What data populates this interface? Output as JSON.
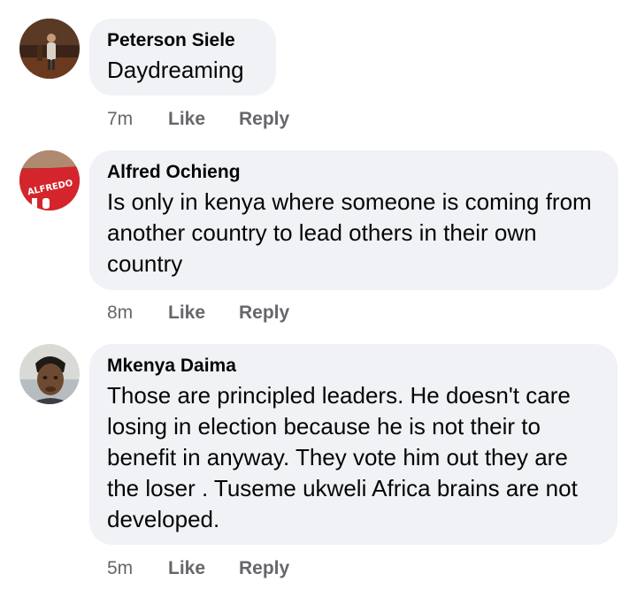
{
  "comments": [
    {
      "author": "Peterson Siele",
      "text": "Daydreaming",
      "time": "7m",
      "like_label": "Like",
      "reply_label": "Reply",
      "avatar_icon": "profile-photo-man-standing"
    },
    {
      "author": "Alfred Ochieng",
      "text": "Is only in kenya where someone is coming from another country to lead others in their own country",
      "time": "8m",
      "like_label": "Like",
      "reply_label": "Reply",
      "avatar_icon": "profile-photo-red-jersey",
      "avatar_text": "ALFREDO"
    },
    {
      "author": "Mkenya Daima",
      "text": "Those are principled leaders. He doesn't care losing in election because he is not their to benefit in anyway. They vote him out they are the loser . Tuseme ukweli Africa brains are not developed.",
      "time": "5m",
      "like_label": "Like",
      "reply_label": "Reply",
      "avatar_icon": "profile-photo-man-face"
    }
  ],
  "colors": {
    "bubble_bg": "#f0f2f5",
    "text": "#050505",
    "meta": "#65676b"
  }
}
